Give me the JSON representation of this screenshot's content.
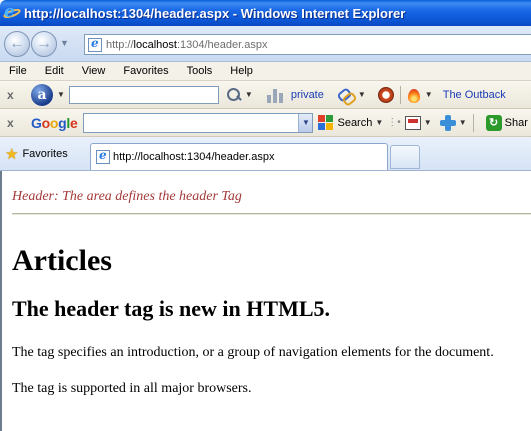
{
  "window": {
    "title": "http://localhost:1304/header.aspx - Windows Internet Explorer"
  },
  "address_bar": {
    "url_prefix": "http://",
    "url_host": "localhost",
    "url_rest": ":1304/header.aspx"
  },
  "menu": {
    "items": [
      "File",
      "Edit",
      "View",
      "Favorites",
      "Tools",
      "Help"
    ]
  },
  "ask_toolbar": {
    "close": "x",
    "logo_letter": "a",
    "search_value": "",
    "private_label": "private",
    "outback_label": "The Outback"
  },
  "google_toolbar": {
    "close": "x",
    "logo": [
      "G",
      "o",
      "o",
      "g",
      "l",
      "e"
    ],
    "search_value": "",
    "search_label": "Search",
    "share_label": "Shar"
  },
  "tabs": {
    "favorites_label": "Favorites",
    "active_tab_title": "http://localhost:1304/header.aspx"
  },
  "content": {
    "header_note": "Header: The area defines the header Tag",
    "heading1": "Articles",
    "heading2": "The header tag is new in HTML5.",
    "paragraph1": "The tag specifies an introduction, or a group of navigation elements for the document.",
    "paragraph2": "The tag is supported in all major browsers."
  },
  "colors": {
    "titlebar": "#0c55d4",
    "header_note": "#a33a3a",
    "link": "#1a3cb4"
  }
}
